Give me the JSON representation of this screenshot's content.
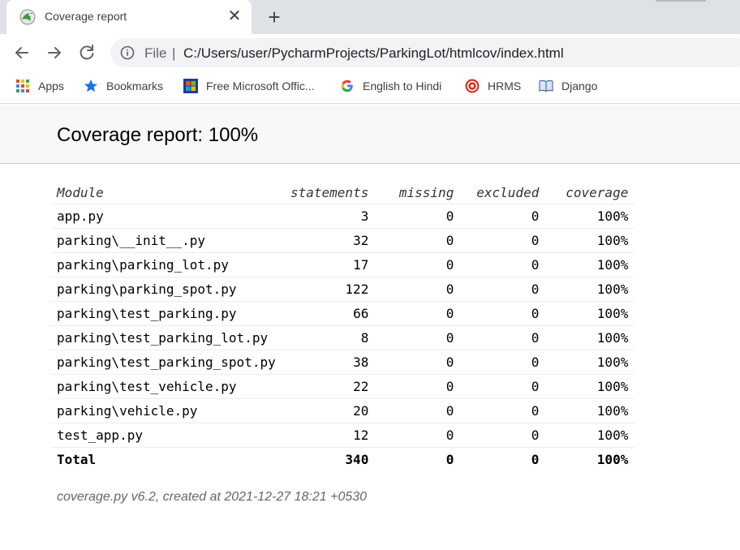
{
  "browser": {
    "tab": {
      "title": "Coverage report",
      "close_glyph": "✕",
      "favicon": "coverage-favicon"
    },
    "new_tab_glyph": "+",
    "toolbar": {
      "back_icon": "back-arrow-icon",
      "forward_icon": "forward-arrow-icon",
      "reload_icon": "reload-icon",
      "scheme": "File",
      "separator": "|",
      "url": "C:/Users/user/PycharmProjects/ParkingLot/htmlcov/index.html"
    },
    "bookmarks": [
      {
        "label": "Apps",
        "icon": "apps-grid-icon"
      },
      {
        "label": "Bookmarks",
        "icon": "star-icon"
      },
      {
        "label": "Free Microsoft Offic...",
        "icon": "microsoft-logo-icon"
      },
      {
        "label": "English to Hindi",
        "icon": "google-g-icon"
      },
      {
        "label": "HRMS",
        "icon": "hrms-icon"
      },
      {
        "label": "Django",
        "icon": "book-icon"
      }
    ]
  },
  "report": {
    "title": "Coverage report: 100%",
    "columns": {
      "module": "Module",
      "statements": "statements",
      "missing": "missing",
      "excluded": "excluded",
      "coverage": "coverage"
    },
    "rows": [
      {
        "module": "app.py",
        "statements": "3",
        "missing": "0",
        "excluded": "0",
        "coverage": "100%"
      },
      {
        "module": "parking\\__init__.py",
        "statements": "32",
        "missing": "0",
        "excluded": "0",
        "coverage": "100%"
      },
      {
        "module": "parking\\parking_lot.py",
        "statements": "17",
        "missing": "0",
        "excluded": "0",
        "coverage": "100%"
      },
      {
        "module": "parking\\parking_spot.py",
        "statements": "122",
        "missing": "0",
        "excluded": "0",
        "coverage": "100%"
      },
      {
        "module": "parking\\test_parking.py",
        "statements": "66",
        "missing": "0",
        "excluded": "0",
        "coverage": "100%"
      },
      {
        "module": "parking\\test_parking_lot.py",
        "statements": "8",
        "missing": "0",
        "excluded": "0",
        "coverage": "100%"
      },
      {
        "module": "parking\\test_parking_spot.py",
        "statements": "38",
        "missing": "0",
        "excluded": "0",
        "coverage": "100%"
      },
      {
        "module": "parking\\test_vehicle.py",
        "statements": "22",
        "missing": "0",
        "excluded": "0",
        "coverage": "100%"
      },
      {
        "module": "parking\\vehicle.py",
        "statements": "20",
        "missing": "0",
        "excluded": "0",
        "coverage": "100%"
      },
      {
        "module": "test_app.py",
        "statements": "12",
        "missing": "0",
        "excluded": "0",
        "coverage": "100%"
      }
    ],
    "total": {
      "module": "Total",
      "statements": "340",
      "missing": "0",
      "excluded": "0",
      "coverage": "100%"
    },
    "footer": "coverage.py v6.2, created at 2021-12-27 18:21 +0530"
  },
  "colors": {
    "tabstrip": "#dee1e6",
    "omnibox": "#f1f3f4",
    "header_bg": "#f8f8f8",
    "footer_text": "#666666"
  }
}
